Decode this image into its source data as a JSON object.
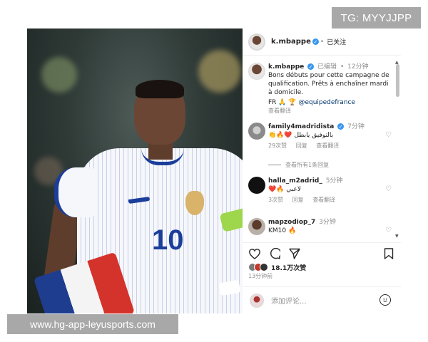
{
  "watermark_top": "TG: MYYJJPP",
  "watermark_bottom": "www.hg-app-leyusports.com",
  "photo": {
    "jersey_number": "10",
    "next_arrow": "›",
    "tag_icon": "person-tag-icon"
  },
  "header": {
    "username": "k.mbappe",
    "verified_mark": "✓",
    "dot": "•",
    "follow_status": "已关注"
  },
  "caption": {
    "username": "k.mbappe",
    "edited": "已编辑",
    "dot": "•",
    "time": "12分钟",
    "text": "Bons débuts pour cette campagne de qualification. Prêts à enchaîner mardi à domicile.",
    "flags": "FR 🙏 🏆",
    "mention": "@equipedefrance",
    "translate": "查看翻译"
  },
  "comments": [
    {
      "username": "family4madridista",
      "time": "7分钟",
      "text": "👏🔥❤️ بالتوفيق يابطل",
      "likes": "29次赞",
      "reply": "回复",
      "translate": "查看翻译"
    },
    {
      "username": "halla_m2adrid_",
      "time": "5分钟",
      "text": "❤️🔥 لاعبي",
      "likes": "3次赞",
      "reply": "回复",
      "translate": "查看翻译"
    },
    {
      "username": "mapzodiop_7",
      "time": "3分钟",
      "text": "KM10 🔥",
      "likes": "",
      "reply": "",
      "translate": ""
    }
  ],
  "view_replies": "查看所有1条回复",
  "actions": {
    "like_icon": "heart-icon",
    "comment_icon": "comment-icon",
    "share_icon": "send-icon",
    "save_icon": "bookmark-icon"
  },
  "likes_count": "18.1万次赞",
  "post_time": "13分钟前",
  "add_comment_placeholder": "添加评论...",
  "colors": {
    "verified": "#3897f0",
    "watermark_bg": "#a8a8a8",
    "jersey_blue": "#1b3e9a",
    "muted_text": "#8e8e8e"
  }
}
